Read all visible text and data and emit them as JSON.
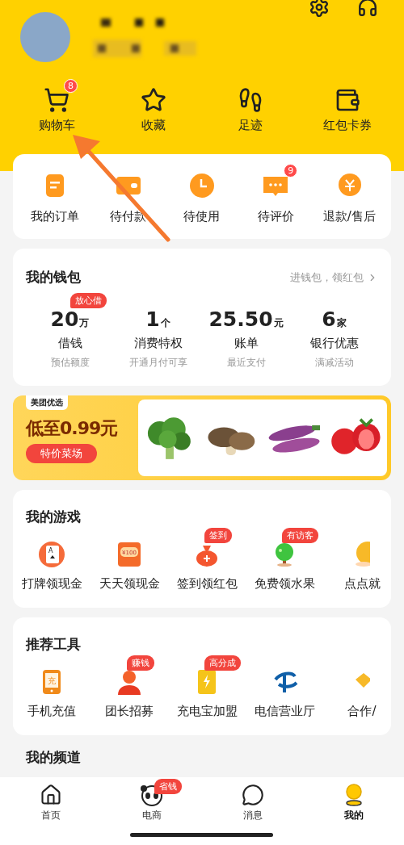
{
  "quick_links": [
    {
      "label": "购物车",
      "badge": "8"
    },
    {
      "label": "收藏"
    },
    {
      "label": "足迹"
    },
    {
      "label": "红包卡券"
    }
  ],
  "orders": [
    {
      "label": "我的订单"
    },
    {
      "label": "待付款"
    },
    {
      "label": "待使用"
    },
    {
      "label": "待评价",
      "badge": "9"
    },
    {
      "label": "退款/售后"
    }
  ],
  "wallet": {
    "title": "我的钱包",
    "link": "进钱包，领红包",
    "items": [
      {
        "value": "20",
        "unit": "万",
        "label": "借钱",
        "sub": "预估额度",
        "tag": "放心借"
      },
      {
        "value": "1",
        "unit": "个",
        "label": "消费特权",
        "sub": "开通月付可享"
      },
      {
        "value": "25.50",
        "unit": "元",
        "label": "账单",
        "sub": "最近支付"
      },
      {
        "value": "6",
        "unit": "家",
        "label": "银行优惠",
        "sub": "满减活动"
      }
    ]
  },
  "banner": {
    "brand": "美团优选",
    "headline": "低至0.99元",
    "button": "特价菜场"
  },
  "games": {
    "title": "我的游戏",
    "items": [
      {
        "label": "打牌领现金",
        "icon_text": "A"
      },
      {
        "label": "天天领现金",
        "icon_text": "¥100"
      },
      {
        "label": "签到领红包",
        "tag": "签到"
      },
      {
        "label": "免费领水果",
        "tag": "有访客"
      },
      {
        "label": "点点就"
      }
    ]
  },
  "tools": {
    "title": "推荐工具",
    "items": [
      {
        "label": "手机充值",
        "icon_text": "充"
      },
      {
        "label": "团长招募",
        "tag": "赚钱"
      },
      {
        "label": "充电宝加盟",
        "tag": "高分成"
      },
      {
        "label": "电信营业厅"
      },
      {
        "label": "合作/"
      }
    ]
  },
  "next_section": {
    "title": "我的频道"
  },
  "tab_bar": [
    {
      "label": "首页",
      "selected": false
    },
    {
      "label": "电商",
      "selected": false,
      "tag": "省钱"
    },
    {
      "label": "消息",
      "selected": false
    },
    {
      "label": "我的",
      "selected": true
    }
  ]
}
